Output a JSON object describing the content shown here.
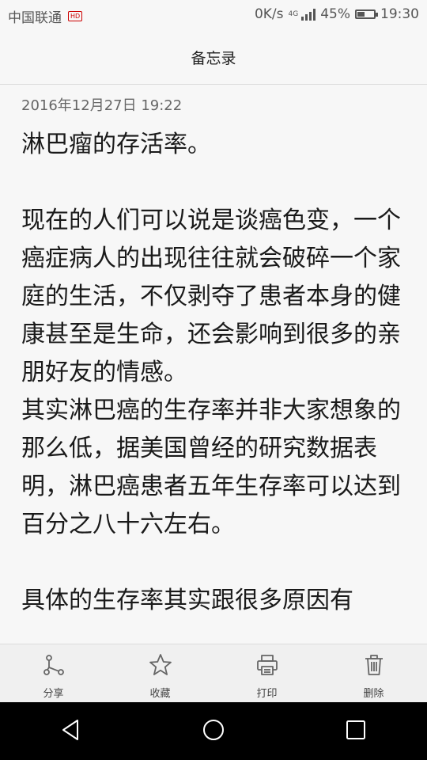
{
  "status_bar": {
    "carrier": "中国联通",
    "carrier_badge": "HD",
    "net_speed": "0K/s",
    "network_type": "4G",
    "battery_percent": "45%",
    "battery_level": 0.45,
    "time": "19:30"
  },
  "header": {
    "title": "备忘录"
  },
  "note": {
    "timestamp": "2016年12月27日 19:22",
    "text": "淋巴瘤的存活率。\n\n现在的人们可以说是谈癌色变，一个癌症病人的出现往往就会破碎一个家庭的生活，不仅剥夺了患者本身的健康甚至是生命，还会影响到很多的亲朋好友的情感。\n其实淋巴癌的生存率并非大家想象的那么低，据美国曾经的研究数据表明，淋巴癌患者五年生存率可以达到百分之八十六左右。\n\n具体的生存率其实跟很多原因有"
  },
  "toolbar": {
    "share": {
      "label": "分享",
      "icon": "share-icon"
    },
    "favorite": {
      "label": "收藏",
      "icon": "star-icon"
    },
    "print": {
      "label": "打印",
      "icon": "printer-icon"
    },
    "delete": {
      "label": "删除",
      "icon": "trash-icon"
    }
  },
  "nav_bar": {
    "icons": [
      "back-icon",
      "home-icon",
      "recents-icon"
    ]
  }
}
